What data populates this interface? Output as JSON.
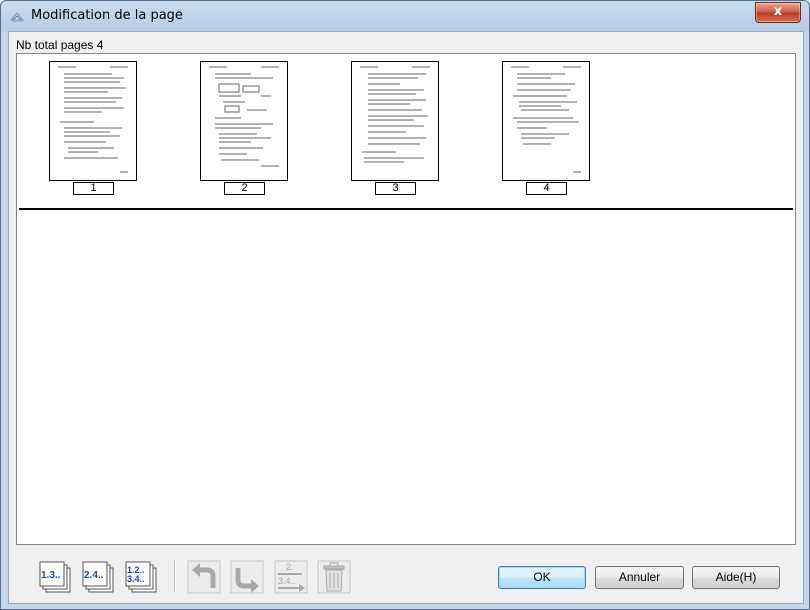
{
  "window": {
    "title": "Modification de la page",
    "close_label": "x"
  },
  "page_count_label": "Nb total pages 4",
  "thumbnails": [
    {
      "label": "1"
    },
    {
      "label": "2"
    },
    {
      "label": "3"
    },
    {
      "label": "4"
    }
  ],
  "toolbar": {
    "odd_pages_icon_text": "1.3..",
    "even_pages_icon_text": "2.4..",
    "all_pages_icon_text_line1": "1.2..",
    "all_pages_icon_text_line2": "3.4..",
    "reorder_icon_text_line1": "2.",
    "reorder_icon_text_line2": "3.4.."
  },
  "buttons": {
    "ok": "OK",
    "cancel": "Annuler",
    "help": "Aide(H)"
  },
  "colors": {
    "title_bar": "#b7cde4",
    "close_button": "#c03a24",
    "default_button_border": "#3c7fb1",
    "page_icon_text": "#1e3fd0"
  }
}
